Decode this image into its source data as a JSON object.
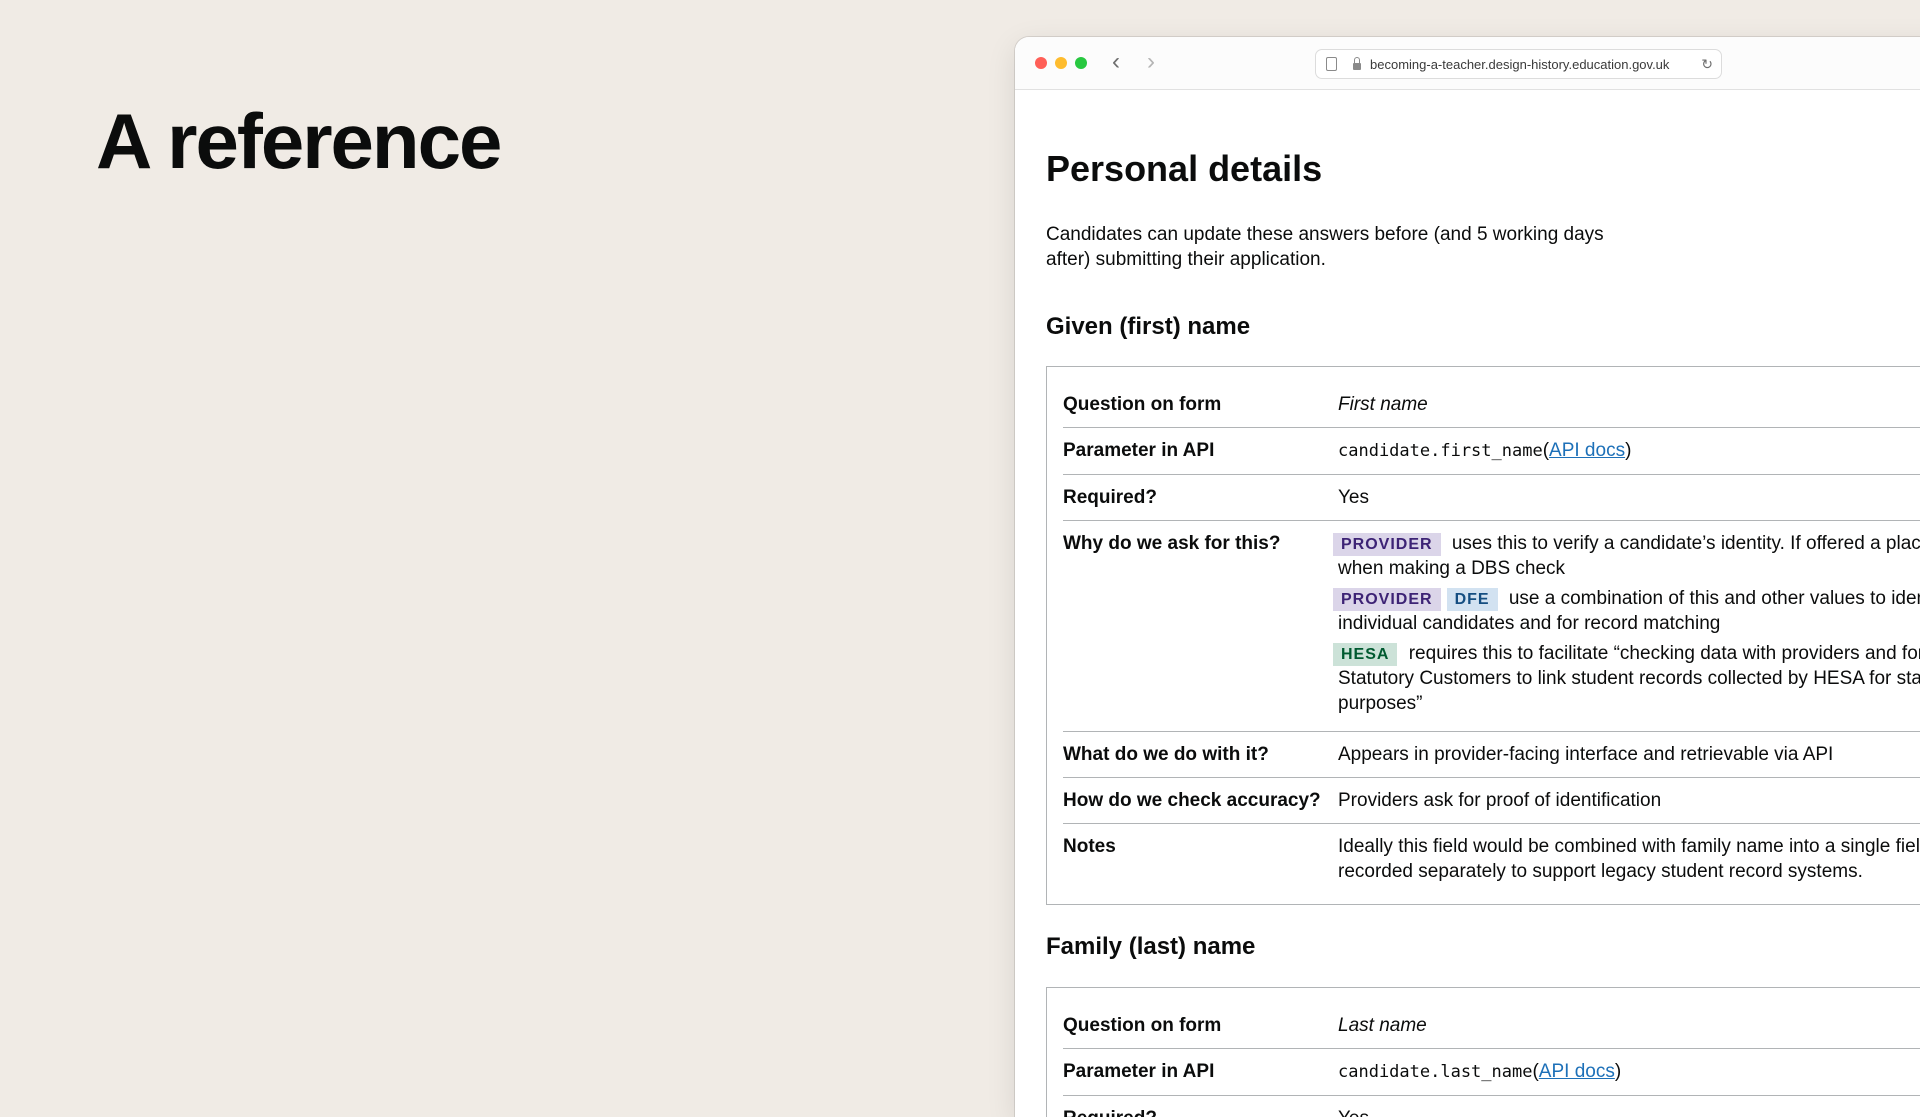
{
  "slide": {
    "title": "A reference"
  },
  "browser": {
    "url": "becoming-a-teacher.design-history.education.gov.uk"
  },
  "page": {
    "title": "Personal details",
    "intro": "Candidates can update these answers before (and 5 working days after) submitting their application."
  },
  "given_name": {
    "heading": "Given (first) name",
    "question_label": "Question on form",
    "question_value": "First name",
    "param_label": "Parameter in API",
    "param_code": "candidate.first_name",
    "param_link": "API docs",
    "required_label": "Required?",
    "required_value": "Yes",
    "why_label": "Why do we ask for this?",
    "why": [
      {
        "tags": [
          "PROVIDER"
        ],
        "text_line1": "uses this to verify a candidate’s identity. If offered a place, it",
        "text_line2": "when making a DBS check"
      },
      {
        "tags": [
          "PROVIDER",
          "DFE"
        ],
        "text_line1": "use a combination of this and other values to identify",
        "text_line2": "individual candidates and for record matching"
      },
      {
        "tags": [
          "HESA"
        ],
        "text_line1": "requires this to facilitate “checking data with providers and for",
        "text_line2": "Statutory Customers to link student records collected by HESA for statis",
        "text_line3": "purposes”"
      }
    ],
    "what_label": "What do we do with it?",
    "what_value": "Appears in provider-facing interface and retrievable via API",
    "accuracy_label": "How do we check accuracy?",
    "accuracy_value": "Providers ask for proof of identification",
    "notes_label": "Notes",
    "notes_line1": "Ideally this field would be combined with family name into a single field. It",
    "notes_line2": "recorded separately to support legacy student record systems."
  },
  "family_name": {
    "heading": "Family (last) name",
    "question_label": "Question on form",
    "question_value": "Last name",
    "param_label": "Parameter in API",
    "param_code": "candidate.last_name",
    "param_link": "API docs",
    "required_label": "Required?",
    "required_value": "Yes"
  }
}
